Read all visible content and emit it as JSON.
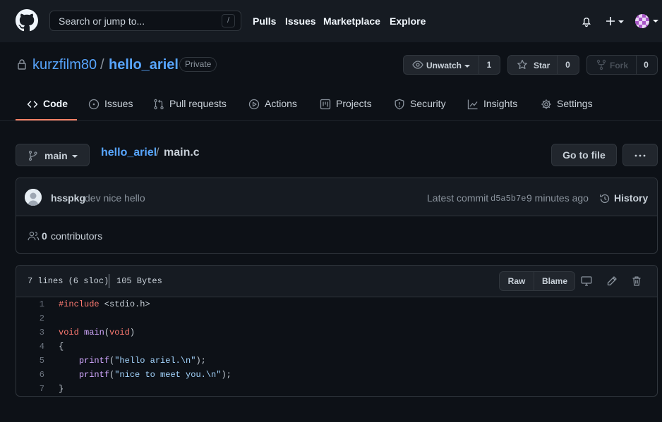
{
  "topnav": {
    "search_placeholder": "Search or jump to...",
    "search_shortcut": "/",
    "links": [
      "Pulls",
      "Issues",
      "Marketplace",
      "Explore"
    ]
  },
  "repo": {
    "owner": "kurzfilm80",
    "separator": "/",
    "name": "hello_ariel",
    "visibility": "Private",
    "watch": {
      "label": "Unwatch",
      "count": "1"
    },
    "star": {
      "label": "Star",
      "count": "0"
    },
    "fork": {
      "label": "Fork",
      "count": "0"
    }
  },
  "tabs": [
    {
      "label": "Code",
      "icon": "code-icon",
      "active": true
    },
    {
      "label": "Issues",
      "icon": "issue-opened-icon"
    },
    {
      "label": "Pull requests",
      "icon": "git-pull-request-icon"
    },
    {
      "label": "Actions",
      "icon": "play-icon"
    },
    {
      "label": "Projects",
      "icon": "project-icon"
    },
    {
      "label": "Security",
      "icon": "shield-icon"
    },
    {
      "label": "Insights",
      "icon": "graph-icon"
    },
    {
      "label": "Settings",
      "icon": "gear-icon"
    }
  ],
  "file_nav": {
    "branch": "main",
    "breadcrumb_repo": "hello_ariel",
    "breadcrumb_sep": "/",
    "file_name": "main.c",
    "go_to_file": "Go to file"
  },
  "commit": {
    "author": "hsspkg",
    "message": "dev nice hello",
    "latest_label": "Latest commit",
    "sha": "d5a5b7e",
    "time": "9 minutes ago",
    "history_label": "History",
    "contributors_count": "0",
    "contributors_label": "contributors"
  },
  "file": {
    "lines_info": "7 lines (6 sloc)",
    "size": "105 Bytes",
    "raw_label": "Raw",
    "blame_label": "Blame",
    "code": [
      {
        "n": "1",
        "text": "#include <stdio.h>"
      },
      {
        "n": "2",
        "text": ""
      },
      {
        "n": "3",
        "text": "void main(void)"
      },
      {
        "n": "4",
        "text": "{"
      },
      {
        "n": "5",
        "text": "    printf(\"hello ariel.\\n\");"
      },
      {
        "n": "6",
        "text": "    printf(\"nice to meet you.\\n\");"
      },
      {
        "n": "7",
        "text": "}"
      }
    ]
  },
  "colors": {
    "background": "#0d1117",
    "header": "#161b22",
    "link": "#58a6ff",
    "tab_underline": "#f78166",
    "keyword": "#ff7b72",
    "function": "#d2a8ff",
    "string": "#a5d6ff"
  }
}
